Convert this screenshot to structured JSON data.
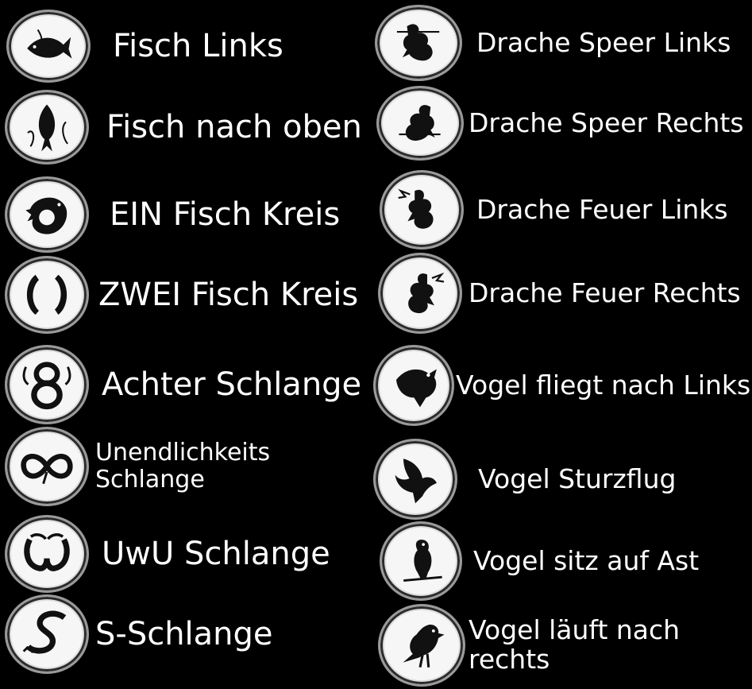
{
  "left": [
    {
      "label": "Fisch Links",
      "icon": "fish-left-icon"
    },
    {
      "label": "Fisch nach oben",
      "icon": "fish-up-icon"
    },
    {
      "label": "EIN Fisch Kreis",
      "icon": "one-fish-circle-icon"
    },
    {
      "label": "ZWEI Fisch Kreis",
      "icon": "two-fish-circle-icon"
    },
    {
      "label": "Achter Schlange",
      "icon": "figure-eight-snake-icon"
    },
    {
      "label": "Unendlichkeits Schlange",
      "icon": "infinity-snake-icon"
    },
    {
      "label": "UwU Schlange",
      "icon": "uwu-snake-icon"
    },
    {
      "label": "S-Schlange",
      "icon": "s-snake-icon"
    }
  ],
  "right": [
    {
      "label": "Drache Speer Links",
      "icon": "dragon-spear-left-icon"
    },
    {
      "label": "Drache Speer Rechts",
      "icon": "dragon-spear-right-icon"
    },
    {
      "label": "Drache Feuer Links",
      "icon": "dragon-fire-left-icon"
    },
    {
      "label": "Drache Feuer Rechts",
      "icon": "dragon-fire-right-icon"
    },
    {
      "label": "Vogel fliegt nach Links",
      "icon": "bird-flying-left-icon"
    },
    {
      "label": "Vogel Sturzflug",
      "icon": "bird-diving-icon"
    },
    {
      "label": "Vogel sitz auf Ast",
      "icon": "bird-on-branch-icon"
    },
    {
      "label": "Vogel läuft nach rechts",
      "icon": "bird-walking-right-icon"
    }
  ],
  "colors": {
    "background": "#000000",
    "text": "#ffffff",
    "token": "#f6f6f6",
    "glyph": "#111111"
  }
}
